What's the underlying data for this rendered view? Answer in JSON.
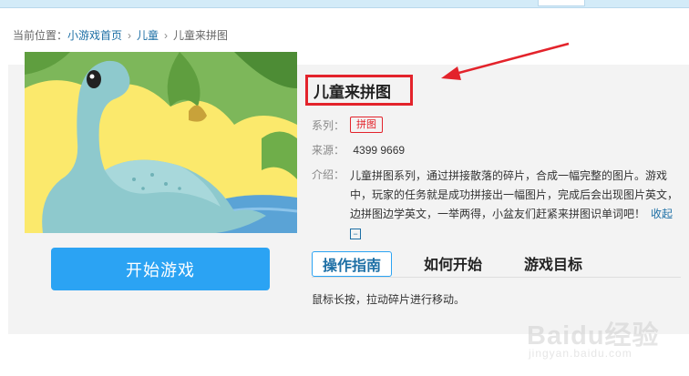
{
  "breadcrumb": {
    "prefix": "当前位置：",
    "items": [
      "小游戏首页",
      "儿童",
      "儿童来拼图"
    ],
    "separator": "›"
  },
  "game": {
    "title": "儿童来拼图",
    "series_label": "系列：",
    "series_tag": "拼图",
    "source_label": "来源：",
    "source_value": "4399 9669",
    "intro_label": "介绍：",
    "intro_text": "儿童拼图系列，通过拼接散落的碎片，合成一幅完整的图片。游戏中，玩家的任务就是成功拼接出一幅图片，完成后会出现图片英文，边拼图边学英文，一举两得，小盆友们赶紧来拼图识单词吧！",
    "collapse_label": "收起",
    "collapse_icon": "−"
  },
  "play_button_label": "开始游戏",
  "tabs": [
    {
      "label": "操作指南",
      "active": true
    },
    {
      "label": "如何开始",
      "active": false
    },
    {
      "label": "游戏目标",
      "active": false
    }
  ],
  "tab_content": "鼠标长按，拉动碎片进行移动。",
  "watermark": {
    "logo": "Baidu经验",
    "url": "jingyan.baidu.com"
  },
  "colors": {
    "accent_blue": "#2ba3f3",
    "highlight_red": "#e3232b",
    "link_blue": "#1d6fa5",
    "panel_bg": "#f3f3f3"
  }
}
